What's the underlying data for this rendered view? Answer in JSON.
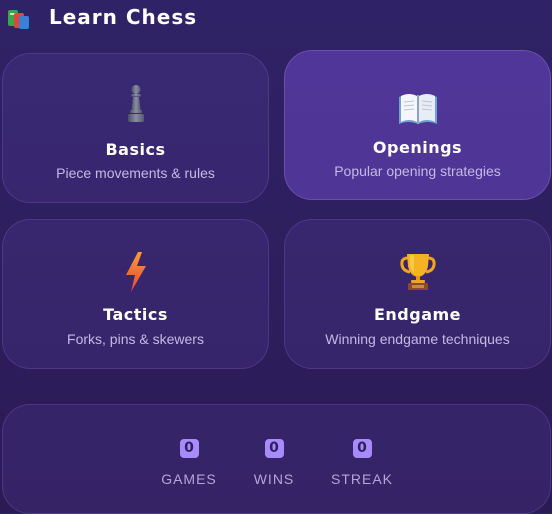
{
  "header": {
    "title": "Learn Chess",
    "icon": "books-icon"
  },
  "cards": [
    {
      "id": "basics",
      "icon": "pawn-icon",
      "title": "Basics",
      "subtitle": "Piece movements & rules",
      "highlighted": false
    },
    {
      "id": "openings",
      "icon": "open-book-icon",
      "title": "Openings",
      "subtitle": "Popular opening strategies",
      "highlighted": true
    },
    {
      "id": "tactics",
      "icon": "lightning-icon",
      "title": "Tactics",
      "subtitle": "Forks, pins & skewers",
      "highlighted": false
    },
    {
      "id": "endgame",
      "icon": "trophy-icon",
      "title": "Endgame",
      "subtitle": "Winning endgame techniques",
      "highlighted": false
    }
  ],
  "stats": [
    {
      "value": "0",
      "label": "GAMES"
    },
    {
      "value": "0",
      "label": "WINS"
    },
    {
      "value": "0",
      "label": "STREAK"
    }
  ],
  "colors": {
    "background": "#2e1f5f",
    "accent": "#a78bfa",
    "highlight_card": "#5b3fa8",
    "subtitle": "#c4b9e4"
  }
}
